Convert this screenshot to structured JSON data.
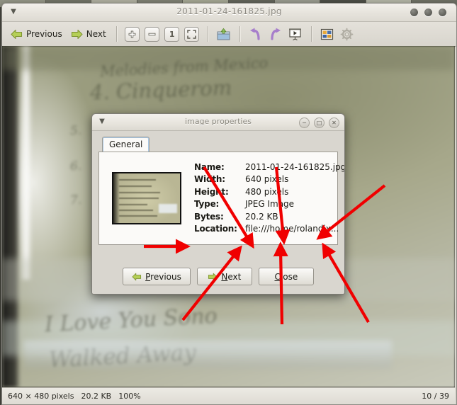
{
  "window": {
    "title": "2011-01-24-161825.jpg",
    "menu_icon": "triangle-down-icon",
    "controls": [
      "minimize-dot",
      "maximize-dot",
      "close-dot"
    ]
  },
  "toolbar": {
    "previous_label": "Previous",
    "next_label": "Next",
    "buttons": [
      {
        "name": "zoom-in-icon",
        "glyph": "+"
      },
      {
        "name": "zoom-out-icon",
        "glyph": "–"
      },
      {
        "name": "zoom-normal-icon",
        "glyph": "1"
      },
      {
        "name": "zoom-fit-icon",
        "glyph": "⤡"
      }
    ],
    "open_icon": "open-folder-icon",
    "rotate_left_icon": "rotate-left-icon",
    "rotate_right_icon": "rotate-right-icon",
    "slideshow_icon": "slideshow-icon",
    "thumbnails_icon": "thumbnails-grid-icon",
    "preferences_icon": "gear-icon"
  },
  "statusbar": {
    "dimensions": "640 × 480 pixels",
    "filesize": "20.2 KB",
    "zoom": "100%",
    "position": "10 / 39"
  },
  "dialog": {
    "title": "image properties",
    "menu_icon": "triangle-down-icon",
    "controls": [
      {
        "name": "minimize-button",
        "glyph": "─"
      },
      {
        "name": "maximize-button",
        "glyph": "□"
      },
      {
        "name": "close-button",
        "glyph": "✕"
      }
    ],
    "tab": "General",
    "thumbnail_alt": "image-thumbnail",
    "properties": [
      {
        "label": "Name:",
        "value": "2011-01-24-161825.jpg"
      },
      {
        "label": "Width:",
        "value": "640 pixels"
      },
      {
        "label": "Height:",
        "value": "480 pixels"
      },
      {
        "label": "Type:",
        "value": "JPEG Image"
      },
      {
        "label": "Bytes:",
        "value": "20.2 KB"
      },
      {
        "label": "Location:",
        "value": "file:///home/rolandix..."
      }
    ],
    "buttons": [
      {
        "name": "dialog-previous-button",
        "pre": "",
        "accel": "P",
        "post": "revious",
        "icon": "arrow-left-icon"
      },
      {
        "name": "dialog-next-button",
        "pre": "",
        "accel": "N",
        "post": "ext",
        "icon": "arrow-right-icon"
      },
      {
        "name": "dialog-close-button",
        "pre": "",
        "accel": "C",
        "post": "lose",
        "icon": ""
      }
    ]
  },
  "annotations": {
    "color": "#f00000",
    "count": 6,
    "description": "red arrows pointing at the Location row"
  },
  "colors": {
    "accent_green": "#a6c34a",
    "accent_purple": "#a678c8",
    "annotation_red": "#f00000",
    "chrome": "#d9d6cf",
    "panel": "#fbfaf8"
  }
}
